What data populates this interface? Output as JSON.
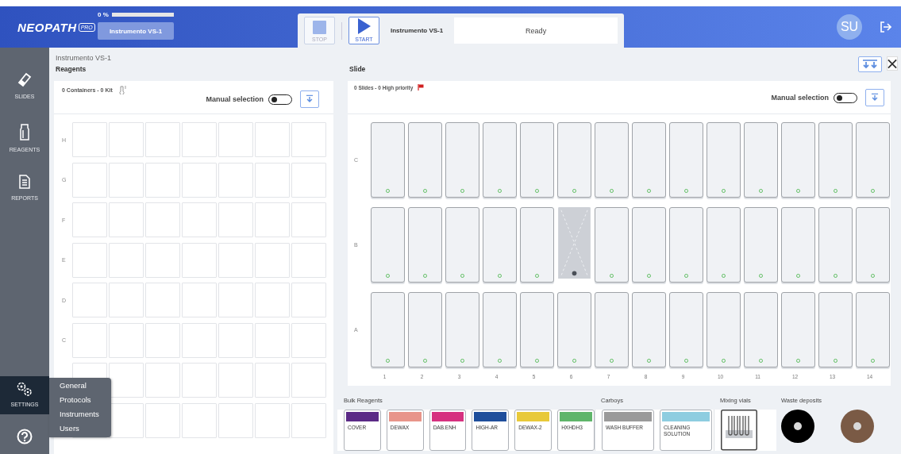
{
  "header": {
    "logo": {
      "name": "NEOPATH",
      "badge": "PRO"
    },
    "progress": {
      "label": "0 %",
      "level": 0
    },
    "instrument_button": "Instrumento VS-1",
    "stop": {
      "label": "STOP",
      "disabled": true
    },
    "start": {
      "label": "START",
      "disabled": false
    },
    "instrument_name": "Instrumento VS-1",
    "status": "Ready",
    "avatar": "SU"
  },
  "sidebar": {
    "items": [
      {
        "label": "SLIDES",
        "kind": "slides",
        "selected": false
      },
      {
        "label": "REAGENTS",
        "kind": "reagents",
        "selected": false
      },
      {
        "label": "REPORTS",
        "kind": "reports",
        "selected": false
      },
      {
        "label": "SETTINGS",
        "kind": "settings",
        "selected": true,
        "expanded": true,
        "menu": [
          "General",
          "Protocols",
          "Instruments",
          "Users"
        ]
      },
      {
        "kind": "help",
        "selected": false
      }
    ]
  },
  "breadcrumb": "Instrumento VS-1",
  "reagents": {
    "title": "Reagents",
    "summary": "0 Containers - 0 Kit",
    "manual_selection": {
      "label": "Manual selection",
      "on": false
    },
    "rows": [
      {
        "label": "H"
      },
      {
        "label": "G"
      },
      {
        "label": "F"
      },
      {
        "label": "E"
      },
      {
        "label": "D"
      },
      {
        "label": "C"
      },
      {},
      {}
    ]
  },
  "slide": {
    "title": "Slide",
    "summary": "0 Slides - 0 High priority",
    "manual_selection": {
      "label": "Manual selection",
      "on": false
    },
    "rows": [
      {
        "label": "C",
        "slots": [
          {
            "disabled": false
          },
          {
            "disabled": false
          },
          {
            "disabled": false
          },
          {
            "disabled": false
          },
          {
            "disabled": false
          },
          {
            "disabled": false
          },
          {
            "disabled": false
          },
          {
            "disabled": false
          },
          {
            "disabled": false
          },
          {
            "disabled": false
          },
          {
            "disabled": false
          },
          {
            "disabled": false
          },
          {
            "disabled": false
          },
          {
            "disabled": false
          }
        ]
      },
      {
        "label": "B",
        "slots": [
          {
            "disabled": false
          },
          {
            "disabled": false
          },
          {
            "disabled": false
          },
          {
            "disabled": false
          },
          {
            "disabled": false
          },
          {
            "disabled": true
          },
          {
            "disabled": false
          },
          {
            "disabled": false
          },
          {
            "disabled": false
          },
          {
            "disabled": false
          },
          {
            "disabled": false
          },
          {
            "disabled": false
          },
          {
            "disabled": false
          },
          {
            "disabled": false
          }
        ]
      },
      {
        "label": "A",
        "slots": [
          {
            "disabled": false
          },
          {
            "disabled": false
          },
          {
            "disabled": false
          },
          {
            "disabled": false
          },
          {
            "disabled": false
          },
          {
            "disabled": false
          },
          {
            "disabled": false
          },
          {
            "disabled": false
          },
          {
            "disabled": false
          },
          {
            "disabled": false
          },
          {
            "disabled": false
          },
          {
            "disabled": false
          },
          {
            "disabled": false
          },
          {
            "disabled": false
          }
        ]
      }
    ],
    "columns": [
      "1",
      "2",
      "3",
      "4",
      "5",
      "6",
      "7",
      "8",
      "9",
      "10",
      "11",
      "12",
      "13",
      "14"
    ]
  },
  "bulk": {
    "sections": [
      {
        "title": "Bulk Reagents",
        "kind": "bottles",
        "items": [
          {
            "label": "COVER",
            "color": "#5b2a86"
          },
          {
            "label": "DEWAX",
            "color": "#e8958a"
          },
          {
            "label": "DAB.ENH",
            "color": "#d6317f"
          },
          {
            "label": "HIGH-AR",
            "color": "#1f4e9b"
          },
          {
            "label": "DEWAX-2",
            "color": "#e8c93a"
          },
          {
            "label": "HXHDH3",
            "color": "#5fb56a"
          }
        ]
      },
      {
        "title": "Carboys",
        "kind": "carboys",
        "items": [
          {
            "label": "WASH BUFFER",
            "color": "#9a9a9a"
          },
          {
            "label": "CLEANING SOLUTION",
            "color": "#8ecde0"
          }
        ]
      },
      {
        "title": "Mixing vials",
        "kind": "vials"
      },
      {
        "title": "Waste deposits",
        "kind": "waste",
        "items": [
          {
            "color": "#000000"
          },
          {
            "color": "#7a5a45"
          }
        ]
      }
    ]
  }
}
